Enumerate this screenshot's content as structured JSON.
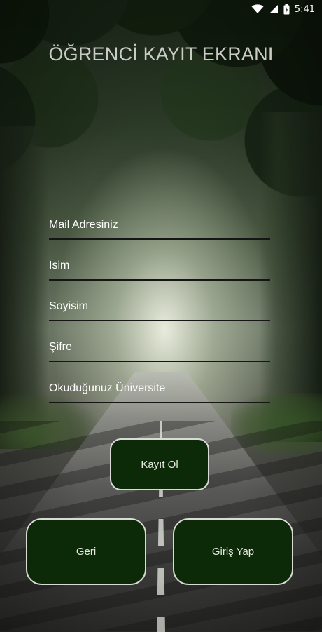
{
  "status_bar": {
    "time": "5:41",
    "icons": [
      "wifi-icon",
      "signal-icon",
      "battery-icon"
    ]
  },
  "title": "ÖĞRENCİ KAYIT EKRANI",
  "form": {
    "email_placeholder": "Mail Adresiniz",
    "email_value": "",
    "name_placeholder": "İsim",
    "name_value": "",
    "surname_placeholder": "Soyisim",
    "surname_value": "",
    "password_placeholder": "Şifre",
    "password_value": "",
    "university_placeholder": "Okuduğunuz Üniversite",
    "university_value": ""
  },
  "buttons": {
    "register": "Kayıt Ol",
    "back": "Geri",
    "login": "Giriş Yap"
  },
  "colors": {
    "button_fill": "#0d2a08",
    "button_border": "#d9dcd4",
    "title_text": "#c9cbc4",
    "field_underline": "#151515"
  }
}
